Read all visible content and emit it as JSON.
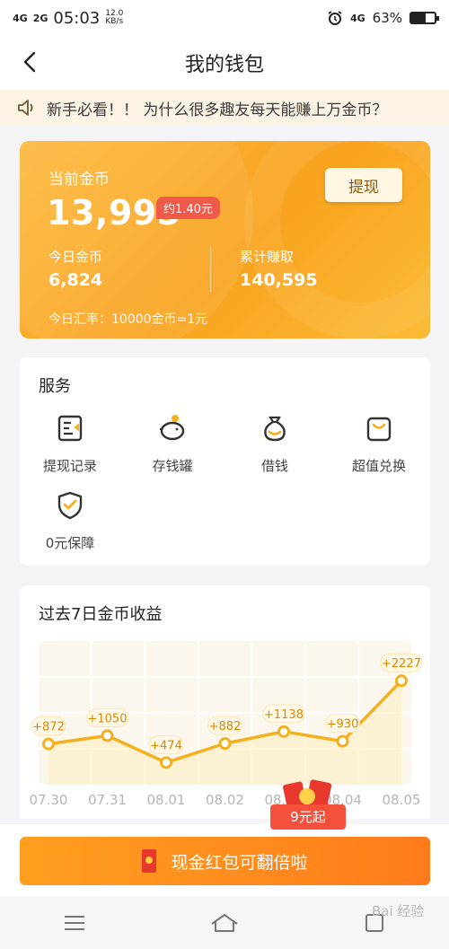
{
  "status_bar": {
    "network1": "4G",
    "network2": "2G",
    "time": "05:03",
    "speed_value": "12.0",
    "speed_unit": "KB/s",
    "network3": "4G",
    "battery_percent": "63%",
    "battery_level": 0.63
  },
  "header": {
    "title": "我的钱包",
    "back_icon": "chevron-left-icon"
  },
  "notice": {
    "text": "新手必看！！ 为什么很多趣友每天能赚上万金币？",
    "icon": "speaker-icon"
  },
  "wallet": {
    "current_label": "当前金币",
    "current_coins": "13,995",
    "approx_value": "约1.40元",
    "withdraw_label": "提现",
    "today_label": "今日金币",
    "today_value": "6,824",
    "total_label": "累计赚取",
    "total_value": "140,595",
    "rate_text": "今日汇率：10000金币=1元",
    "colors": {
      "card_start": "#fdb93d",
      "card_end": "#f9a31f",
      "badge": "#f05a4a"
    }
  },
  "services": {
    "title": "服务",
    "items": [
      {
        "label": "提现记录",
        "icon": "withdraw-record-icon"
      },
      {
        "label": "存钱罐",
        "icon": "piggy-bank-icon"
      },
      {
        "label": "借钱",
        "icon": "money-bag-icon"
      },
      {
        "label": "超值兑换",
        "icon": "shopping-bag-icon"
      },
      {
        "label": "0元保障",
        "icon": "shield-check-icon"
      }
    ]
  },
  "chart_data": {
    "type": "line",
    "title": "过去7日金币收益",
    "categories": [
      "07.30",
      "07.31",
      "08.01",
      "08.02",
      "08.03",
      "08.04",
      "08.05"
    ],
    "values": [
      872,
      1050,
      474,
      882,
      1138,
      930,
      2227
    ],
    "data_labels": [
      "+872",
      "+1050",
      "+474",
      "+882",
      "+1138",
      "+930",
      "+2227"
    ],
    "ylim": [
      0,
      2400
    ],
    "grid": true,
    "line_color": "#f5b01e"
  },
  "promo": {
    "badge_text": "9元起",
    "button_label": "现金红包可翻倍啦"
  },
  "bottom_nav": {
    "items": [
      "menu-icon",
      "home-icon",
      "back-square-icon"
    ]
  },
  "watermark": "Bai 经验"
}
